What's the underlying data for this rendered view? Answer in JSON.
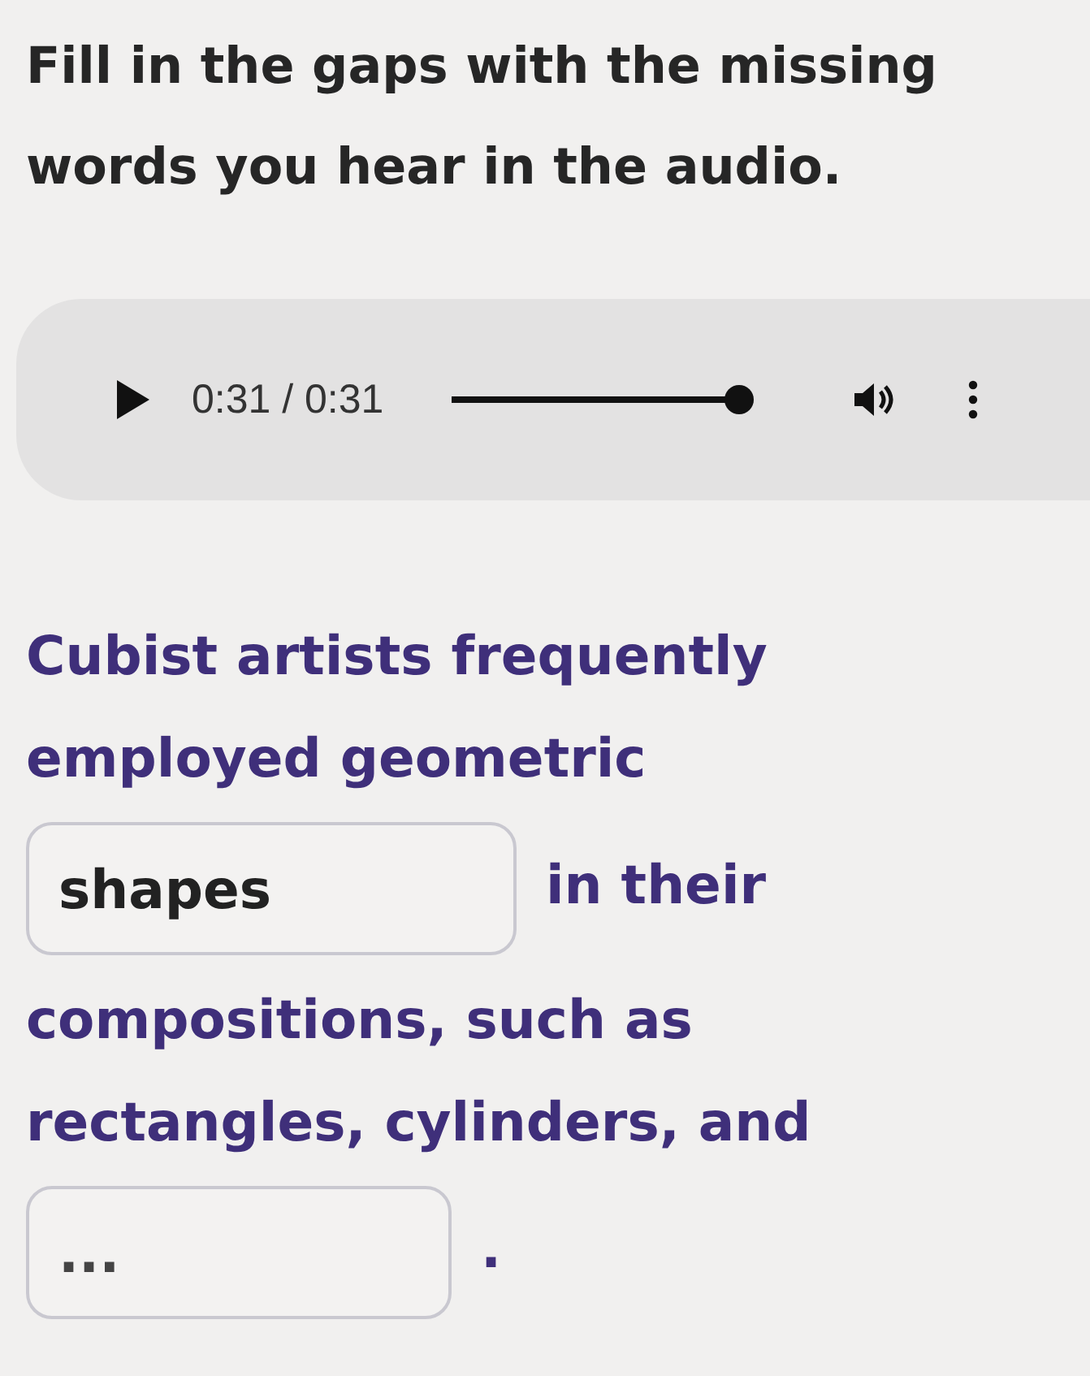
{
  "instruction": "Fill in the gaps with the missing words you hear in the audio.",
  "audio_player": {
    "time": "0:31 / 0:31",
    "level": 1
  },
  "sentence": [
    {
      "kind": "text",
      "text": "Cubist artists frequently"
    },
    {
      "kind": "text",
      "text": "employed geometric"
    },
    {
      "kind": "blank",
      "value": "shapes"
    },
    {
      "kind": "text",
      "text": "in their"
    },
    {
      "kind": "text",
      "text": "compositions, such as"
    },
    {
      "kind": "text",
      "text": "rectangles, cylinders, and"
    },
    {
      "kind": "blank",
      "placeholder": "..."
    },
    {
      "kind": "text",
      "text": "."
    }
  ]
}
